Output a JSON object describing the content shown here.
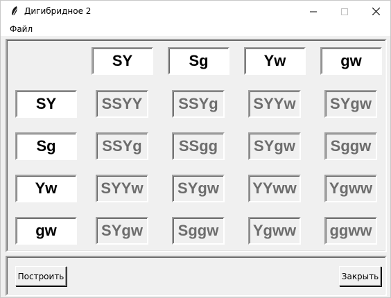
{
  "window": {
    "title": "Дигибридное 2",
    "icon": "feather-icon"
  },
  "menu": {
    "items": [
      {
        "label": "Файл"
      }
    ]
  },
  "grid": {
    "column_headers": [
      "SY",
      "Sg",
      "Yw",
      "gw"
    ],
    "row_headers": [
      "SY",
      "Sg",
      "Yw",
      "gw"
    ],
    "cells": [
      [
        "SSYY",
        "SSYg",
        "SYYw",
        "SYgw"
      ],
      [
        "SSYg",
        "SSgg",
        "SYgw",
        "Sggw"
      ],
      [
        "SYYw",
        "SYgw",
        "YYww",
        "Ygww"
      ],
      [
        "SYgw",
        "Sggw",
        "Ygww",
        "ggww"
      ]
    ]
  },
  "buttons": {
    "build_label": "Построить",
    "close_label": "Закрыть"
  },
  "colors": {
    "window_bg": "#f0f0f0",
    "header_text": "#000000",
    "combo_text": "#6d6d6d"
  }
}
